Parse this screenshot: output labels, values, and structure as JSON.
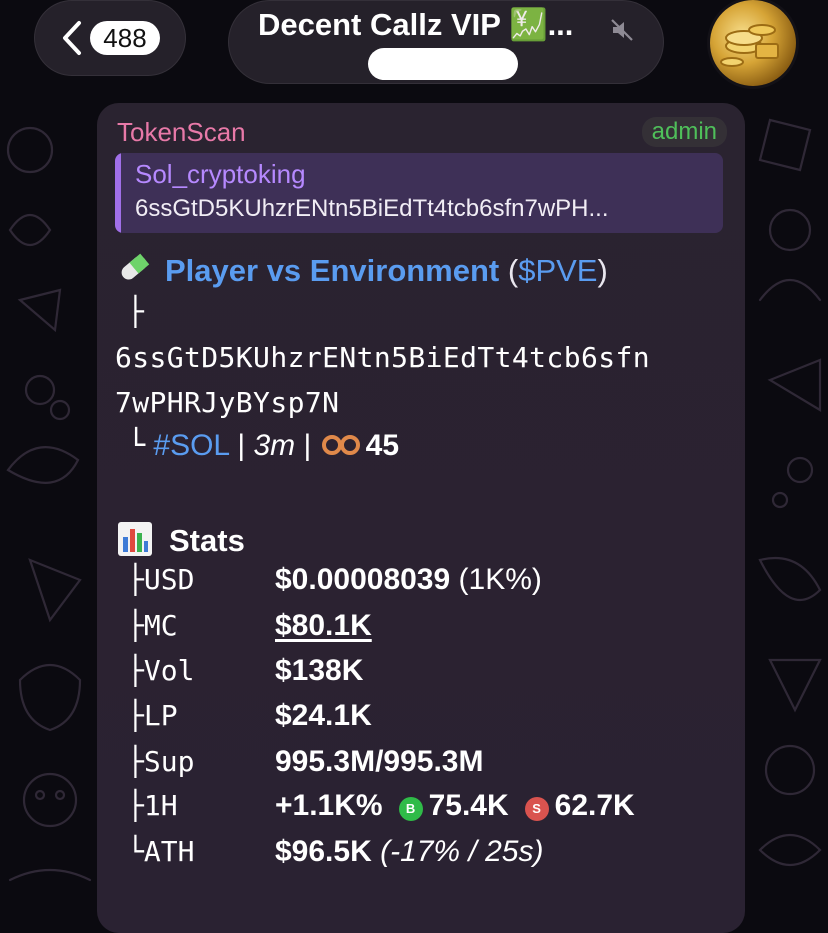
{
  "header": {
    "unread_count": "488",
    "chat_title": "Decent Callz VIP 💹...",
    "icons": {
      "back": "chevron-left-icon",
      "mute": "muted-speaker-icon"
    }
  },
  "message": {
    "sender": "TokenScan",
    "role_badge": "admin",
    "reply": {
      "author": "Sol_cryptoking",
      "text": "6ssGtD5KUhzrENtn5BiEdTt4tcb6sfn7wPH..."
    },
    "token": {
      "name": "Player vs Environment",
      "symbol": "$PVE",
      "icon": "pill-icon",
      "branch_top": "├",
      "address_line1": "6ssGtD5KUhzrENtn5BiEdTt4tcb6sfn",
      "address_line2": "7wPHRJyBYsp7N",
      "branch_end": "└",
      "chain_tag": "#SOL",
      "separator": "|",
      "age": "3m",
      "views_icon": "eyeglasses-icon",
      "views": "45"
    },
    "stats": {
      "title": "Stats",
      "icon": "bar-chart-icon",
      "rows": [
        {
          "branch": "├",
          "key": "USD",
          "value": "$0.00008039",
          "extra": " (1K%)"
        },
        {
          "branch": "├",
          "key": "MC",
          "value": "$80.1K"
        },
        {
          "branch": "├",
          "key": "Vol",
          "value": "$138K"
        },
        {
          "branch": "├",
          "key": "LP",
          "value": "$24.1K"
        },
        {
          "branch": "├",
          "key": "Sup",
          "value": "995.3M/995.3M"
        },
        {
          "branch": "├",
          "key": "1H",
          "value": "+1.1K%",
          "buy_label": "B",
          "buy": "75.4K",
          "sell_label": "S",
          "sell": "62.7K"
        },
        {
          "branch": "└",
          "key": "ATH",
          "value": "$96.5K",
          "extra": " (-17% / 25s)"
        }
      ]
    }
  },
  "colors": {
    "link": "#5a9cf0",
    "sender": "#e879a8",
    "admin": "#4fbf5a",
    "reply_author": "#b689ff",
    "buy": "#2fbb48",
    "sell": "#d9534f"
  }
}
